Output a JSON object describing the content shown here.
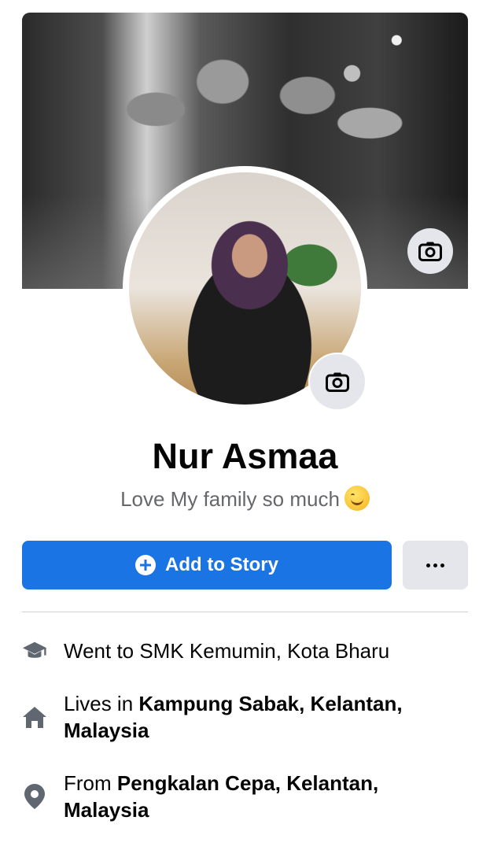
{
  "profile": {
    "name": "Nur Asmaa",
    "bio": "Love My family so much"
  },
  "icons": {
    "cover_camera": "camera-icon",
    "avatar_camera": "camera-icon",
    "add_story": "plus-circle-icon",
    "more": "more-dots-icon",
    "education": "graduation-cap-icon",
    "home": "home-icon",
    "location": "location-pin-icon"
  },
  "actions": {
    "add_story_label": "Add to Story",
    "more_label": "..."
  },
  "details": {
    "education": {
      "text": "Went to SMK Kemumin, Kota Bharu"
    },
    "lives": {
      "prefix": "Lives in ",
      "place": "Kampung Sabak, Kelantan, Malaysia"
    },
    "from": {
      "prefix": "From ",
      "place": "Pengkalan Cepa, Kelantan, Malaysia"
    }
  },
  "colors": {
    "primary_button": "#1b74e4",
    "secondary_button": "#e4e6eb",
    "secondary_text": "#65676b",
    "divider": "#ced0d4"
  }
}
